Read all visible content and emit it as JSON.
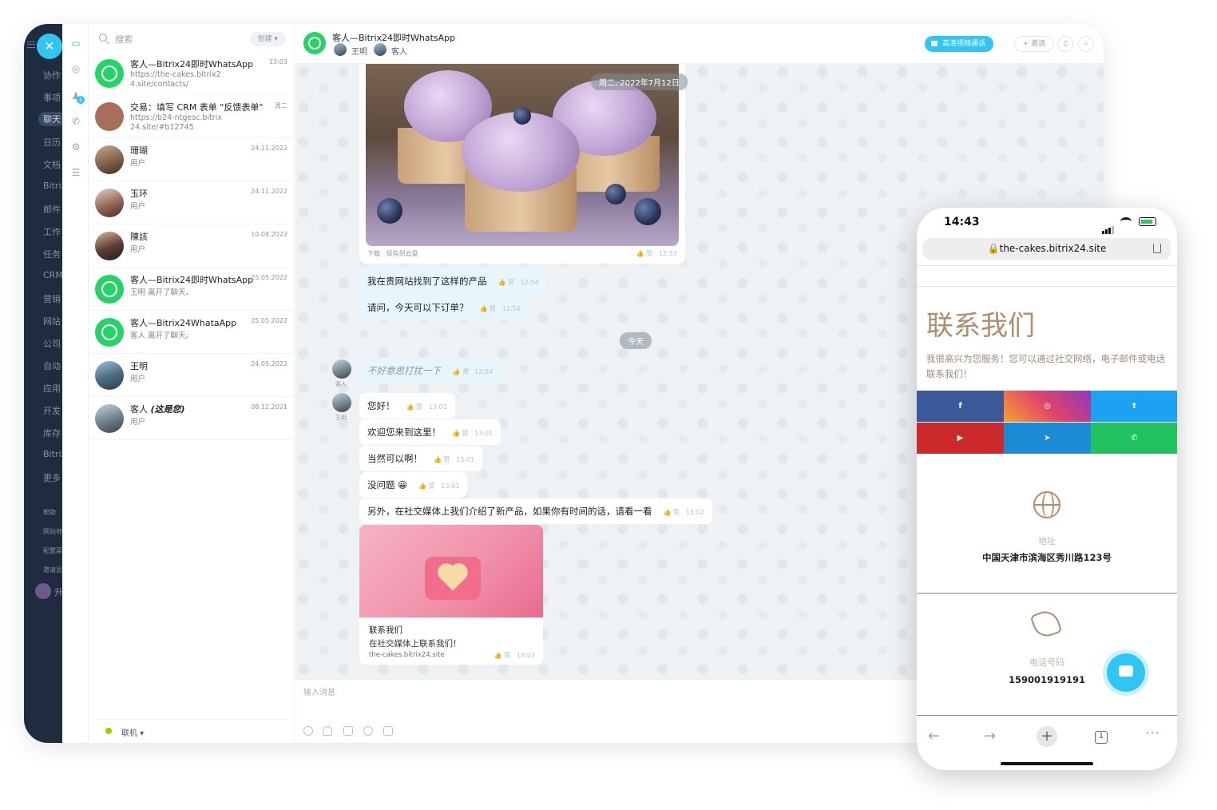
{
  "left_nav": {
    "items": [
      "协作",
      "事项",
      "聊天",
      "日历",
      "文档",
      "Bitrix",
      "邮件",
      "工作",
      "任务",
      "CRM",
      "营销",
      "网站",
      "公司",
      "自动",
      "应用",
      "开发",
      "库存",
      "Bitrix",
      "更多"
    ],
    "small_items": [
      "帮助",
      "网站地",
      "配置菜",
      "邀请员"
    ],
    "selected": "聊天",
    "upgrade_label": "升"
  },
  "search": {
    "placeholder": "搜索",
    "create_label": "创建"
  },
  "chats": [
    {
      "title": "客人—Bitrix24即时WhatsApp",
      "date": "13:03",
      "line1": "https://the-cakes.bitrix2",
      "line2": "4.site/contacts/",
      "avatar": "whatsapp"
    },
    {
      "title": "交易：填写 CRM 表单 \"反馈表单\"",
      "date": "周二",
      "line1": "https://b24-ntgesc.bitrix",
      "line2": "24.site/#b12745",
      "avatar": "crm"
    },
    {
      "title": "珊瑚",
      "date": "24.11.2022",
      "line1": "用户",
      "avatar": "person"
    },
    {
      "title": "玉环",
      "date": "24.11.2022",
      "line1": "用户",
      "avatar": "person"
    },
    {
      "title": "陳該",
      "date": "10.08.2022",
      "line1": "用户",
      "avatar": "person"
    },
    {
      "title": "客人—Bitrix24即时WhatsApp",
      "date": "25.05.2022",
      "line1": "王明 离开了聊天。",
      "avatar": "whatsapp"
    },
    {
      "title": "客人—Bitrix24WhataApp",
      "date": "25.05.2022",
      "line1": "客人 离开了聊天。",
      "avatar": "whatsapp"
    },
    {
      "title": "王明",
      "date": "24.05.2022",
      "line1": "用户",
      "avatar": "person"
    },
    {
      "title": "客人",
      "title_extra": "(这是您)",
      "date": "08.12.2021",
      "line1": "用户",
      "avatar": "person"
    }
  ],
  "status": {
    "label": "联机"
  },
  "header": {
    "title": "客人—Bitrix24即时WhatsApp",
    "member1": "王明",
    "member2": "客人",
    "video_label": "高清视频通话",
    "invite_label": "邀请"
  },
  "messages": {
    "date_pill": "周二, 2022年7月12日",
    "card_meta_download": "下载",
    "card_meta_save": "保存到云盘",
    "card_time": "12:53",
    "m1": "我在贵网站找到了这样的产品",
    "m1_time": "12:54",
    "m2": "请问，今天可以下订单？",
    "m2_time": "12:54",
    "today_pill": "今天",
    "m3": "不好意思打扰一下",
    "m3_time": "12:54",
    "m3_author": "客人",
    "m4": "您好！",
    "m4_time": "13:01",
    "m4_author": "王明",
    "m5": "欢迎您来到这里！",
    "m5_time": "13:01",
    "m6": "当然可以啊！",
    "m6_time": "13:01",
    "m7": "没问题 😀",
    "m7_time": "13:01",
    "m8": "另外，在社交媒体上我们介绍了新产品，如果你有时间的话，请看一看",
    "m8_time": "13:02",
    "like_label": "赞",
    "link_title": "联系我们",
    "link_desc": "在社交媒体上联系我们！",
    "link_url": "the-cakes.bitrix24.site",
    "link_time": "13:03"
  },
  "input": {
    "placeholder": "输入消息"
  },
  "phone": {
    "time": "14:43",
    "url": "the-cakes.bitrix24.site",
    "heading": "联系我们",
    "intro": "我很高兴为您服务！您可以通过社交网络，电子邮件或电话联系我们！",
    "social": [
      {
        "name": "facebook",
        "color": "#3b5998",
        "glyph": "f"
      },
      {
        "name": "instagram",
        "color": "#e0446a",
        "glyph": "◎"
      },
      {
        "name": "twitter",
        "color": "#1da1f2",
        "glyph": "t"
      },
      {
        "name": "youtube",
        "color": "#cc2a2a",
        "glyph": "▶"
      },
      {
        "name": "telegram",
        "color": "#1c8bd6",
        "glyph": "➤"
      },
      {
        "name": "whatsapp",
        "color": "#1fc25e",
        "glyph": "✆"
      }
    ],
    "address_label": "地址",
    "address": "中国天津市滨海区秀川路123号",
    "phone_label": "电话号码",
    "phone_number": "159001919191",
    "tabs_count": "1"
  }
}
